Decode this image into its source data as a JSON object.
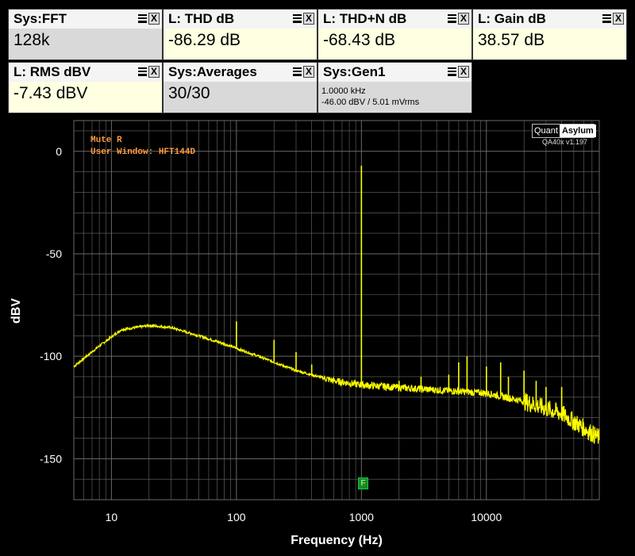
{
  "tiles": [
    {
      "title": "Sys:FFT",
      "value": "128k"
    },
    {
      "title": "L: THD dB",
      "value": "-86.29 dB"
    },
    {
      "title": "L: THD+N dB",
      "value": "-68.43 dB"
    },
    {
      "title": "L: Gain dB",
      "value": "38.57 dB"
    },
    {
      "title": "L: RMS dBV",
      "value": "-7.43 dBV"
    },
    {
      "title": "Sys:Averages",
      "value": "30/30"
    },
    {
      "title": "Sys:Gen1",
      "line1": "1.0000 kHz",
      "line2": "-46.00 dBV  /  5.01 mVrms"
    }
  ],
  "tile_controls": {
    "close": "X"
  },
  "colors": {
    "trace": "#ffff00",
    "grid": "#6a6a6a",
    "note": "#ff9a3c",
    "tile_yellow": "#ffffe1",
    "tile_grey": "#d9d9d9"
  },
  "plot": {
    "notes": [
      "Mute R",
      "User Window: HFT144D"
    ],
    "logo_left": "Quant",
    "logo_right": "Asylum",
    "version": "QA40x v1.197",
    "marker": "F"
  },
  "chart_data": {
    "type": "line",
    "xlabel": "Frequency (Hz)",
    "ylabel": "dBV",
    "xscale": "log",
    "xlim": [
      5,
      80000
    ],
    "ylim": [
      -170,
      15
    ],
    "x_ticks": [
      "10",
      "100",
      "1000",
      "10000"
    ],
    "y_ticks": [
      "0",
      "-50",
      "-100",
      "-150"
    ],
    "grid": true,
    "series": [
      {
        "noise_floor": [
          [
            5,
            -105
          ],
          [
            8,
            -95
          ],
          [
            12,
            -87
          ],
          [
            20,
            -85
          ],
          [
            30,
            -86
          ],
          [
            50,
            -90
          ],
          [
            80,
            -94
          ],
          [
            150,
            -100
          ],
          [
            300,
            -107
          ],
          [
            600,
            -112
          ],
          [
            1000,
            -114
          ],
          [
            3000,
            -116
          ],
          [
            10000,
            -118
          ],
          [
            20000,
            -122
          ],
          [
            40000,
            -128
          ],
          [
            80000,
            -140
          ]
        ],
        "peaks": [
          [
            100,
            -83
          ],
          [
            200,
            -92
          ],
          [
            300,
            -98
          ],
          [
            400,
            -104
          ],
          [
            1000,
            -7
          ],
          [
            2000,
            -112
          ],
          [
            3000,
            -110
          ],
          [
            5000,
            -109
          ],
          [
            6000,
            -103
          ],
          [
            7000,
            -100
          ],
          [
            10000,
            -105
          ],
          [
            13000,
            -103
          ],
          [
            15000,
            -110
          ],
          [
            20000,
            -107
          ],
          [
            25000,
            -112
          ],
          [
            30000,
            -115
          ],
          [
            40000,
            -115
          ]
        ]
      }
    ]
  }
}
